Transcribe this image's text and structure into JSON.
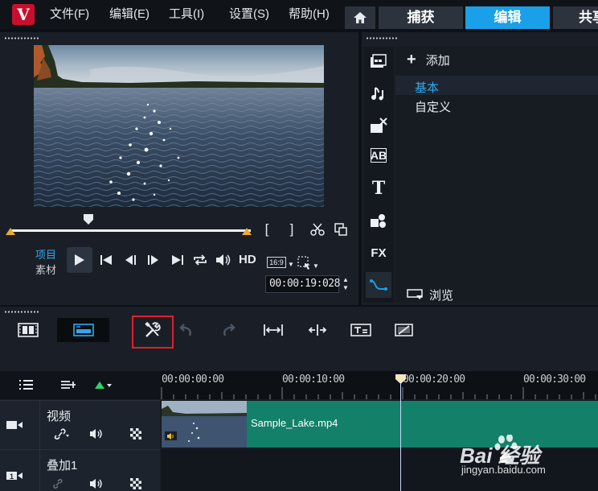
{
  "menu": {
    "logo": "V",
    "items": [
      "文件(F)",
      "编辑(E)",
      "工具(I)",
      "设置(S)",
      "帮助(H)"
    ]
  },
  "mode_tabs": [
    "捕获",
    "编辑",
    "共享"
  ],
  "preview": {
    "mode_project": "项目",
    "mode_clip": "素材",
    "quality": "HD",
    "aspect": "16:9",
    "timecode": "00:00:19:028"
  },
  "library": {
    "add_label": "添加",
    "items": [
      "基本",
      "自定义"
    ],
    "selected_index": 0,
    "browse_label": "浏览",
    "icons": [
      "media-icon",
      "audio-icon",
      "transition-icon",
      "title-icon",
      "text-icon",
      "graphics-icon",
      "fx-icon",
      "path-icon"
    ],
    "fx_text": "FX"
  },
  "timeline": {
    "ruler": [
      "00:00:00:00",
      "00:00:10:00",
      "00:00:20:00",
      "00:00:30:00"
    ],
    "tracks": [
      {
        "name": "视频",
        "clip_name": "Sample_Lake.mp4"
      },
      {
        "name": "叠加1"
      }
    ]
  },
  "watermark": {
    "brand": "Bai 经验",
    "url": "jingyan.baidu.com"
  },
  "colors": {
    "accent": "#19a0e8",
    "clip": "#13806a",
    "highlight": "#e0202a",
    "trim": "#f0a830"
  }
}
